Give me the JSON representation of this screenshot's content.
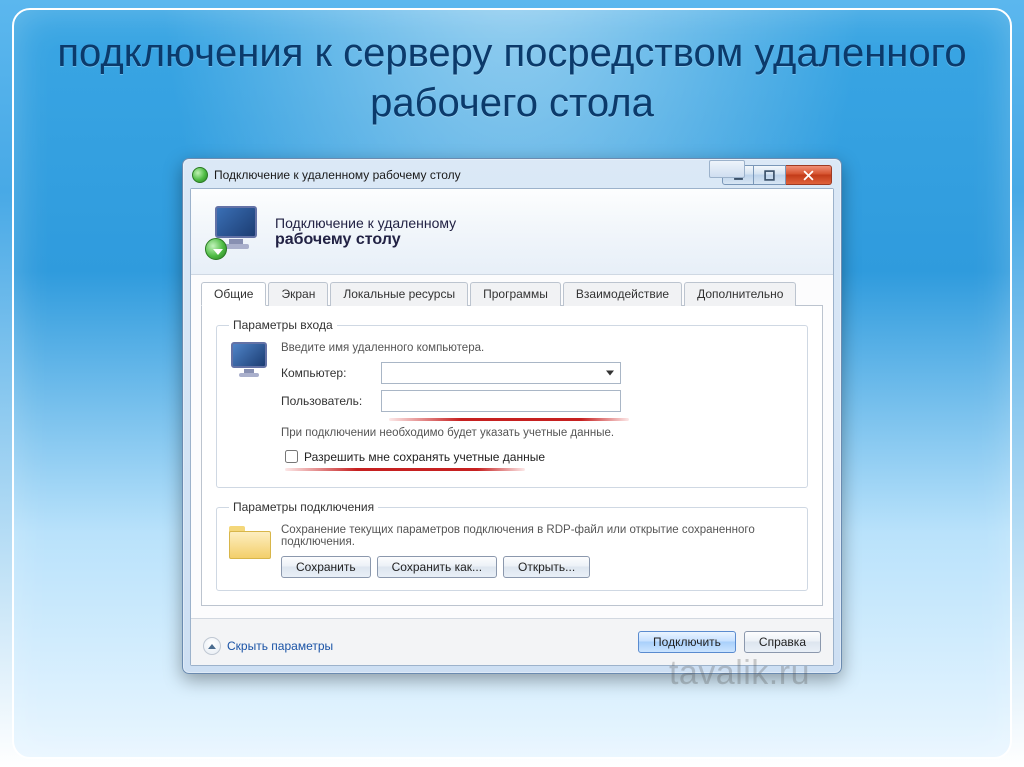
{
  "slide": {
    "title": "подключения к серверу посредством удаленного рабочего стола"
  },
  "window": {
    "title": "Подключение к удаленному рабочему столу",
    "header_line1": "Подключение к удаленному",
    "header_line2": "рабочему столу",
    "tabs": [
      {
        "label": "Общие",
        "active": true
      },
      {
        "label": "Экран"
      },
      {
        "label": "Локальные ресурсы"
      },
      {
        "label": "Программы"
      },
      {
        "label": "Взаимодействие"
      },
      {
        "label": "Дополнительно"
      }
    ],
    "groups": {
      "login": {
        "legend": "Параметры входа",
        "intro": "Введите имя удаленного компьютера.",
        "computer_label": "Компьютер:",
        "computer_value": "",
        "user_label": "Пользователь:",
        "user_value": "",
        "note": "При подключении необходимо будет указать учетные данные.",
        "allow_save_checkbox": "Разрешить мне сохранять учетные данные",
        "allow_save_checked": false
      },
      "connection": {
        "legend": "Параметры подключения",
        "desc": "Сохранение текущих параметров подключения в RDP-файл или открытие сохраненного подключения.",
        "save_btn": "Сохранить",
        "save_as_btn": "Сохранить как...",
        "open_btn": "Открыть..."
      }
    },
    "collapse_link": "Скрыть параметры",
    "connect_btn": "Подключить",
    "help_btn": "Справка"
  },
  "watermark": "tavalik.ru"
}
